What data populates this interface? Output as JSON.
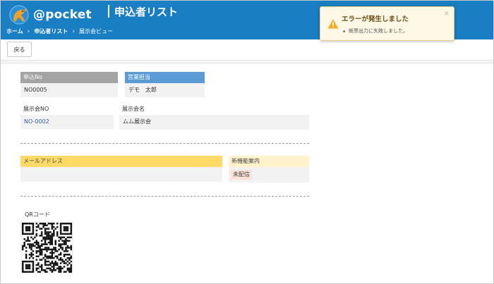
{
  "app": {
    "logo_text": "@pocket",
    "logo_sub": "",
    "page_title": "申込者リスト"
  },
  "breadcrumb": [
    {
      "label": "ホーム",
      "separator": "›"
    },
    {
      "label": "申込者リスト",
      "separator": "›"
    },
    {
      "label": "展示会ビュー"
    }
  ],
  "toolbar": {
    "back_label": "戻る"
  },
  "fields": {
    "application_no": {
      "label": "申込No",
      "value": "NO0005"
    },
    "sales_rep": {
      "label": "営業担当",
      "value": "デモ　太郎"
    },
    "exhibition_no": {
      "label": "展示会NO",
      "value": "NO-0002"
    },
    "exhibition_name": {
      "label": "展示会名",
      "value": "ムム展示会"
    },
    "email": {
      "label": "メールアドレス",
      "value": ""
    },
    "new_feature_info": {
      "label": "新機能案内",
      "value": "未配信"
    },
    "qr_code": {
      "label": "QRコード"
    }
  },
  "toast": {
    "title": "エラーが発生しました",
    "close": "×",
    "messages": [
      "帳票出力に失敗しました。"
    ]
  },
  "colors": {
    "header": "#1a7ec2",
    "label_gray": "#a4a4a4",
    "label_blue": "#5b9bd5",
    "label_yellow": "#ffd966",
    "label_lightyellow": "#fff2cc",
    "toast_bg": "#fff8e6",
    "warning": "#f0ad1f"
  }
}
